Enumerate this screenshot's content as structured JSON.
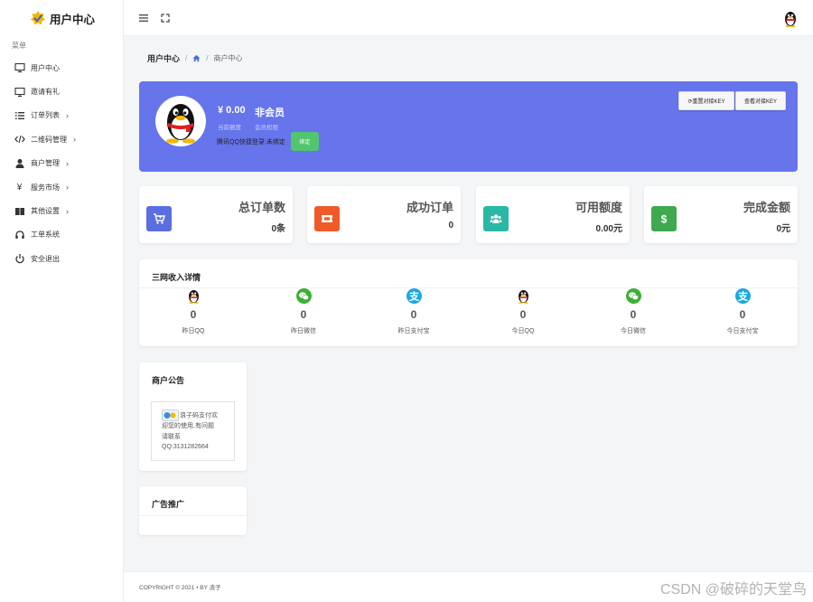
{
  "brand": {
    "title": "用户中心"
  },
  "sidebar": {
    "caption": "菜单",
    "items": [
      {
        "label": "用户中心",
        "icon": "monitor-icon",
        "has_children": false
      },
      {
        "label": "邀请有礼",
        "icon": "monitor-icon",
        "has_children": false
      },
      {
        "label": "订单列表",
        "icon": "list-icon",
        "has_children": true
      },
      {
        "label": "二维码管理",
        "icon": "code-icon",
        "has_children": true
      },
      {
        "label": "商户管理",
        "icon": "user-icon",
        "has_children": true
      },
      {
        "label": "服务市场",
        "icon": "yen-icon",
        "has_children": true
      },
      {
        "label": "其他设置",
        "icon": "book-icon",
        "has_children": true
      },
      {
        "label": "工单系统",
        "icon": "headset-icon",
        "has_children": false
      },
      {
        "label": "安全退出",
        "icon": "power-icon",
        "has_children": false
      }
    ]
  },
  "breadcrumb": {
    "title": "用户中心",
    "current": "商户中心"
  },
  "hero": {
    "balance": "¥ 0.00",
    "level": "非会员",
    "balance_caption": "当前额度",
    "level_caption": "会员权限",
    "qq_text": "腾讯QQ快捷登录:未绑定",
    "bind_label": "绑定",
    "reset_key_label": "⟳重置对接KEY",
    "view_key_label": "查看对接KEY",
    "bg_color": "#6675ec"
  },
  "stats": [
    {
      "label": "总订单数",
      "value": "0条",
      "color": "#5b6ee0",
      "icon": "cart-icon"
    },
    {
      "label": "成功订单",
      "value": "0",
      "color": "#f05a28",
      "icon": "ticket-icon"
    },
    {
      "label": "可用额度",
      "value": "0.00元",
      "color": "#29b8a6",
      "icon": "users-icon"
    },
    {
      "label": "完成金额",
      "value": "0元",
      "color": "#3ea94e",
      "icon": "dollar-icon"
    }
  ],
  "income": {
    "title": "三网收入详情",
    "items": [
      {
        "value": "0",
        "label": "昨日QQ",
        "icon": "qq-icon"
      },
      {
        "value": "0",
        "label": "昨日微信",
        "icon": "wechat-icon"
      },
      {
        "value": "0",
        "label": "昨日支付宝",
        "icon": "alipay-icon"
      },
      {
        "value": "0",
        "label": "今日QQ",
        "icon": "qq-icon"
      },
      {
        "value": "0",
        "label": "今日微信",
        "icon": "wechat-icon"
      },
      {
        "value": "0",
        "label": "今日支付宝",
        "icon": "alipay-icon"
      }
    ]
  },
  "notice": {
    "title": "商户公告",
    "line1": "浪子码支付欢",
    "line2": "迎您的使用,有问题",
    "line3": "请联系",
    "line4": "QQ:3131282664"
  },
  "ad": {
    "title": "广告推广"
  },
  "footer": {
    "text": "COPYRIGHT © 2021 • BY 浪子"
  },
  "watermark": "CSDN @破碎的天堂鸟"
}
